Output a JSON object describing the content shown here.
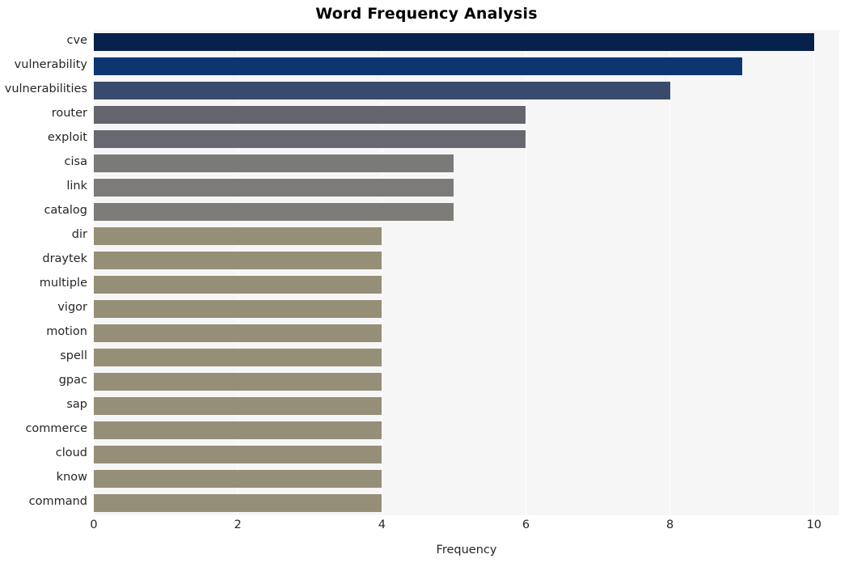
{
  "chart_data": {
    "type": "bar",
    "orientation": "horizontal",
    "title": "Word Frequency Analysis",
    "xlabel": "Frequency",
    "ylabel": "",
    "categories": [
      "cve",
      "vulnerability",
      "vulnerabilities",
      "router",
      "exploit",
      "cisa",
      "link",
      "catalog",
      "dir",
      "draytek",
      "multiple",
      "vigor",
      "motion",
      "spell",
      "gpac",
      "sap",
      "commerce",
      "cloud",
      "know",
      "command"
    ],
    "values": [
      10,
      9,
      8,
      6,
      6,
      5,
      5,
      5,
      4,
      4,
      4,
      4,
      4,
      4,
      4,
      4,
      4,
      4,
      4,
      4
    ],
    "bar_colors": [
      "#06214a",
      "#0d3671",
      "#3a4a6d",
      "#64656d",
      "#686970",
      "#7a7a79",
      "#7c7b79",
      "#7d7c79",
      "#968f77",
      "#968f77",
      "#968f77",
      "#968f77",
      "#968f77",
      "#968f77",
      "#968f77",
      "#968f77",
      "#968f77",
      "#968f77",
      "#968f77",
      "#968f77"
    ],
    "xlim": [
      0,
      10.35
    ],
    "xticks": [
      0,
      2,
      4,
      6,
      8,
      10
    ],
    "xtick_labels": [
      "0",
      "2",
      "4",
      "6",
      "8",
      "10"
    ],
    "grid": true,
    "grid_axis": "x",
    "grid_color": "#ffffff",
    "plot_background": "#f6f6f7",
    "figure_background": "#ffffff",
    "legend": null,
    "style": "seaborn-darkgrid"
  }
}
